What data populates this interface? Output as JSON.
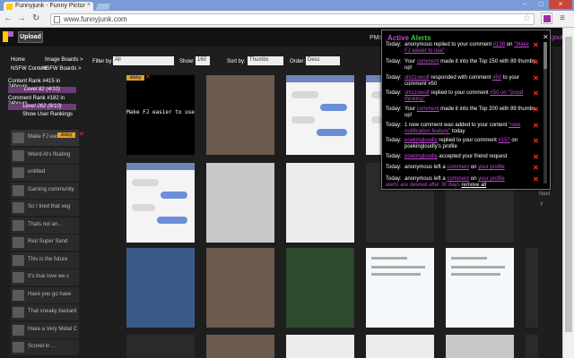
{
  "browser": {
    "tab_title": "Funnyjunk - Funny Pictur",
    "tab_close": "×",
    "url": "www.funnyjunk.com",
    "back": "←",
    "forward": "→",
    "reload": "↻",
    "star": "☆",
    "menu": "≡",
    "win_min": "–",
    "win_max": "□",
    "win_close": "×"
  },
  "header": {
    "upload_label": "Upload",
    "pm_label": "PMs",
    "logout_label": "gout"
  },
  "sidebar": {
    "home": "Home",
    "image_boards": "Image Boards >",
    "nsfw_content": "NSFW Content",
    "nsfw_boards": "NSFW Boards >",
    "content_rank": "Content Rank #415 in 24hours",
    "level_content": "Level 82 (4/10)",
    "comment_rank": "Comment Rank #182 in 24hours",
    "level_comment": "Level 262 (8/10)",
    "show_rankings": "Show User Rankings",
    "sticky_label": "sticky",
    "items": [
      "Make FJ easier to...",
      "Weird Al's floating",
      "untitled",
      "Gaming community",
      "So I tried that veg",
      "Thats not an...",
      "Red Super Sand",
      "This is the future",
      "It's true love we c",
      "Have you go have",
      "That sneaky bastard",
      "Have a Very Metal C",
      "Scovel in ..."
    ]
  },
  "filters": {
    "filter_by_label": "Filter by:",
    "filter_by_value": "All",
    "show_label": "Show:",
    "show_value": "160",
    "sort_by_label": "Sort by:",
    "sort_by_value": "Thumbs",
    "order_label": "Order:",
    "order_value": "Desc"
  },
  "grid": {
    "sticky_label": "sticky",
    "first_thumb_text": "Make FJ easier to use",
    "next_label": "Next",
    "next_arrow": "›",
    "remove_x": "✕"
  },
  "alerts": {
    "title_a": "Active",
    "title_b": "Alerts",
    "close": "✕",
    "remove_x": "✕",
    "remove_all": "remove all",
    "rows": [
      {
        "day": "Today:",
        "pre": "anonymous replied to your comment ",
        "link1": "#138",
        "mid": " on ",
        "link2": "\"Make FJ easier to use\"",
        "post": ""
      },
      {
        "day": "Today:",
        "pre": "Your ",
        "link1": "comment",
        "mid": " made it into the Top 150 with 89 thumbs up!",
        "link2": "",
        "post": ""
      },
      {
        "day": "Today:",
        "pre": "",
        "link1": "shizzowolf",
        "mid": " responded with comment ",
        "link2": "#50",
        "post": " to your comment #50"
      },
      {
        "day": "Today:",
        "pre": "",
        "link1": "shizzowolf",
        "mid": " replied to your comment ",
        "link2": "#50 on \"Good thinking\"",
        "post": ""
      },
      {
        "day": "Today:",
        "pre": "Your ",
        "link1": "comment",
        "mid": " made it into the Top 200 with 89 thumbs up!",
        "link2": "",
        "post": ""
      },
      {
        "day": "Today:",
        "pre": "1 new comment was added to your content ",
        "link1": "\"new notification feature\"",
        "mid": " today",
        "link2": "",
        "post": ""
      },
      {
        "day": "Today:",
        "pre": "",
        "link1": "poekingloudly",
        "mid": " replied to your comment ",
        "link2": "#157",
        "post": " on poekingloudly's profile"
      },
      {
        "day": "Today:",
        "pre": "",
        "link1": "poekingloudly",
        "mid": " accepted your friend request",
        "link2": "",
        "post": ""
      },
      {
        "day": "Today:",
        "pre": "anonymous left a ",
        "link1": "comment",
        "mid": " on ",
        "link2": "your profile",
        "post": ""
      },
      {
        "day": "Today:",
        "pre": "anonymous left a ",
        "link1": "comment",
        "mid": " on ",
        "link2": "your profile",
        "post": ""
      }
    ],
    "footer_pre": "alerts are deleted after 30 days"
  }
}
